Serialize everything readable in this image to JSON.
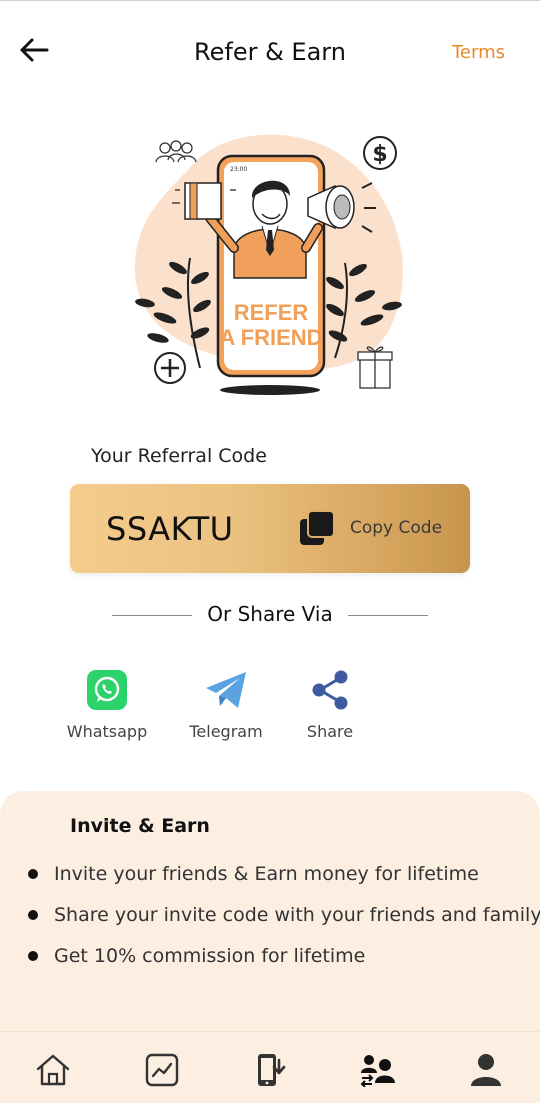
{
  "header": {
    "title": "Refer & Earn",
    "terms_label": "Terms"
  },
  "illustration": {
    "line1": "REFER",
    "line2": "A FRIEND",
    "phone_time": "23:00",
    "accent_color": "#f0a05a"
  },
  "referral": {
    "label": "Your Referral Code",
    "code": "SSAKTU",
    "copy_label": "Copy Code"
  },
  "share": {
    "divider_text": "Or Share Via",
    "items": [
      {
        "label": "Whatsapp",
        "icon": "whatsapp-icon",
        "color": "#25d366"
      },
      {
        "label": "Telegram",
        "icon": "telegram-icon",
        "color": "#5aa3e0"
      },
      {
        "label": "Share",
        "icon": "share-icon",
        "color": "#3e5aa0"
      }
    ]
  },
  "invite": {
    "title": "Invite & Earn",
    "points": [
      "Invite your friends & Earn money for lifetime",
      "Share your invite code with your friends and family",
      "Get 10% commission for lifetime"
    ]
  },
  "bottom_nav": {
    "items": [
      {
        "icon": "home-icon"
      },
      {
        "icon": "chart-icon"
      },
      {
        "icon": "phone-download-icon"
      },
      {
        "icon": "refer-users-icon",
        "active": true
      },
      {
        "icon": "profile-icon"
      }
    ]
  },
  "colors": {
    "accent": "#e8882a",
    "panel_bg": "#fdeee2",
    "card_gradient_start": "#f4cc8c",
    "card_gradient_end": "#c6954d"
  }
}
